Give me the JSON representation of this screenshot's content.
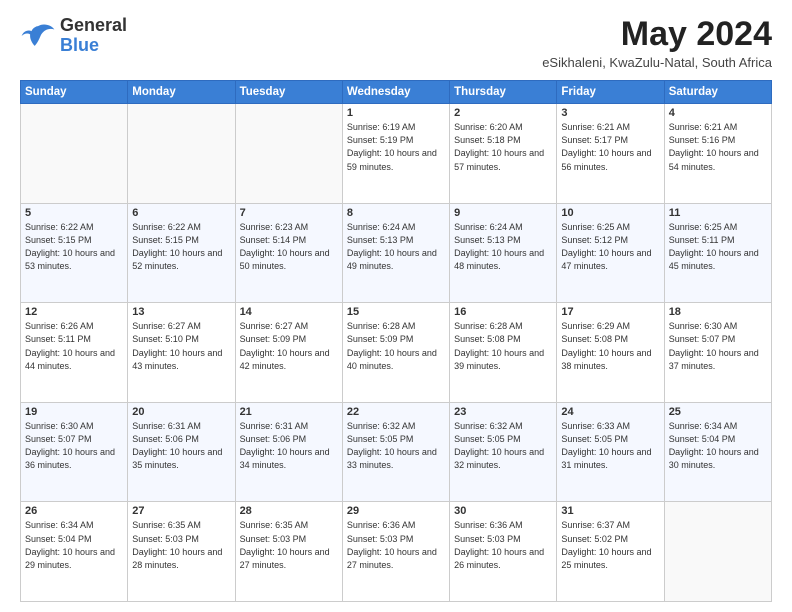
{
  "header": {
    "logo_general": "General",
    "logo_blue": "Blue",
    "month_year": "May 2024",
    "location": "eSikhaleni, KwaZulu-Natal, South Africa"
  },
  "days_of_week": [
    "Sunday",
    "Monday",
    "Tuesday",
    "Wednesday",
    "Thursday",
    "Friday",
    "Saturday"
  ],
  "weeks": [
    [
      {
        "day": "",
        "sunrise": "",
        "sunset": "",
        "daylight": ""
      },
      {
        "day": "",
        "sunrise": "",
        "sunset": "",
        "daylight": ""
      },
      {
        "day": "",
        "sunrise": "",
        "sunset": "",
        "daylight": ""
      },
      {
        "day": "1",
        "sunrise": "Sunrise: 6:19 AM",
        "sunset": "Sunset: 5:19 PM",
        "daylight": "Daylight: 10 hours and 59 minutes."
      },
      {
        "day": "2",
        "sunrise": "Sunrise: 6:20 AM",
        "sunset": "Sunset: 5:18 PM",
        "daylight": "Daylight: 10 hours and 57 minutes."
      },
      {
        "day": "3",
        "sunrise": "Sunrise: 6:21 AM",
        "sunset": "Sunset: 5:17 PM",
        "daylight": "Daylight: 10 hours and 56 minutes."
      },
      {
        "day": "4",
        "sunrise": "Sunrise: 6:21 AM",
        "sunset": "Sunset: 5:16 PM",
        "daylight": "Daylight: 10 hours and 54 minutes."
      }
    ],
    [
      {
        "day": "5",
        "sunrise": "Sunrise: 6:22 AM",
        "sunset": "Sunset: 5:15 PM",
        "daylight": "Daylight: 10 hours and 53 minutes."
      },
      {
        "day": "6",
        "sunrise": "Sunrise: 6:22 AM",
        "sunset": "Sunset: 5:15 PM",
        "daylight": "Daylight: 10 hours and 52 minutes."
      },
      {
        "day": "7",
        "sunrise": "Sunrise: 6:23 AM",
        "sunset": "Sunset: 5:14 PM",
        "daylight": "Daylight: 10 hours and 50 minutes."
      },
      {
        "day": "8",
        "sunrise": "Sunrise: 6:24 AM",
        "sunset": "Sunset: 5:13 PM",
        "daylight": "Daylight: 10 hours and 49 minutes."
      },
      {
        "day": "9",
        "sunrise": "Sunrise: 6:24 AM",
        "sunset": "Sunset: 5:13 PM",
        "daylight": "Daylight: 10 hours and 48 minutes."
      },
      {
        "day": "10",
        "sunrise": "Sunrise: 6:25 AM",
        "sunset": "Sunset: 5:12 PM",
        "daylight": "Daylight: 10 hours and 47 minutes."
      },
      {
        "day": "11",
        "sunrise": "Sunrise: 6:25 AM",
        "sunset": "Sunset: 5:11 PM",
        "daylight": "Daylight: 10 hours and 45 minutes."
      }
    ],
    [
      {
        "day": "12",
        "sunrise": "Sunrise: 6:26 AM",
        "sunset": "Sunset: 5:11 PM",
        "daylight": "Daylight: 10 hours and 44 minutes."
      },
      {
        "day": "13",
        "sunrise": "Sunrise: 6:27 AM",
        "sunset": "Sunset: 5:10 PM",
        "daylight": "Daylight: 10 hours and 43 minutes."
      },
      {
        "day": "14",
        "sunrise": "Sunrise: 6:27 AM",
        "sunset": "Sunset: 5:09 PM",
        "daylight": "Daylight: 10 hours and 42 minutes."
      },
      {
        "day": "15",
        "sunrise": "Sunrise: 6:28 AM",
        "sunset": "Sunset: 5:09 PM",
        "daylight": "Daylight: 10 hours and 40 minutes."
      },
      {
        "day": "16",
        "sunrise": "Sunrise: 6:28 AM",
        "sunset": "Sunset: 5:08 PM",
        "daylight": "Daylight: 10 hours and 39 minutes."
      },
      {
        "day": "17",
        "sunrise": "Sunrise: 6:29 AM",
        "sunset": "Sunset: 5:08 PM",
        "daylight": "Daylight: 10 hours and 38 minutes."
      },
      {
        "day": "18",
        "sunrise": "Sunrise: 6:30 AM",
        "sunset": "Sunset: 5:07 PM",
        "daylight": "Daylight: 10 hours and 37 minutes."
      }
    ],
    [
      {
        "day": "19",
        "sunrise": "Sunrise: 6:30 AM",
        "sunset": "Sunset: 5:07 PM",
        "daylight": "Daylight: 10 hours and 36 minutes."
      },
      {
        "day": "20",
        "sunrise": "Sunrise: 6:31 AM",
        "sunset": "Sunset: 5:06 PM",
        "daylight": "Daylight: 10 hours and 35 minutes."
      },
      {
        "day": "21",
        "sunrise": "Sunrise: 6:31 AM",
        "sunset": "Sunset: 5:06 PM",
        "daylight": "Daylight: 10 hours and 34 minutes."
      },
      {
        "day": "22",
        "sunrise": "Sunrise: 6:32 AM",
        "sunset": "Sunset: 5:05 PM",
        "daylight": "Daylight: 10 hours and 33 minutes."
      },
      {
        "day": "23",
        "sunrise": "Sunrise: 6:32 AM",
        "sunset": "Sunset: 5:05 PM",
        "daylight": "Daylight: 10 hours and 32 minutes."
      },
      {
        "day": "24",
        "sunrise": "Sunrise: 6:33 AM",
        "sunset": "Sunset: 5:05 PM",
        "daylight": "Daylight: 10 hours and 31 minutes."
      },
      {
        "day": "25",
        "sunrise": "Sunrise: 6:34 AM",
        "sunset": "Sunset: 5:04 PM",
        "daylight": "Daylight: 10 hours and 30 minutes."
      }
    ],
    [
      {
        "day": "26",
        "sunrise": "Sunrise: 6:34 AM",
        "sunset": "Sunset: 5:04 PM",
        "daylight": "Daylight: 10 hours and 29 minutes."
      },
      {
        "day": "27",
        "sunrise": "Sunrise: 6:35 AM",
        "sunset": "Sunset: 5:03 PM",
        "daylight": "Daylight: 10 hours and 28 minutes."
      },
      {
        "day": "28",
        "sunrise": "Sunrise: 6:35 AM",
        "sunset": "Sunset: 5:03 PM",
        "daylight": "Daylight: 10 hours and 27 minutes."
      },
      {
        "day": "29",
        "sunrise": "Sunrise: 6:36 AM",
        "sunset": "Sunset: 5:03 PM",
        "daylight": "Daylight: 10 hours and 27 minutes."
      },
      {
        "day": "30",
        "sunrise": "Sunrise: 6:36 AM",
        "sunset": "Sunset: 5:03 PM",
        "daylight": "Daylight: 10 hours and 26 minutes."
      },
      {
        "day": "31",
        "sunrise": "Sunrise: 6:37 AM",
        "sunset": "Sunset: 5:02 PM",
        "daylight": "Daylight: 10 hours and 25 minutes."
      },
      {
        "day": "",
        "sunrise": "",
        "sunset": "",
        "daylight": ""
      }
    ]
  ]
}
